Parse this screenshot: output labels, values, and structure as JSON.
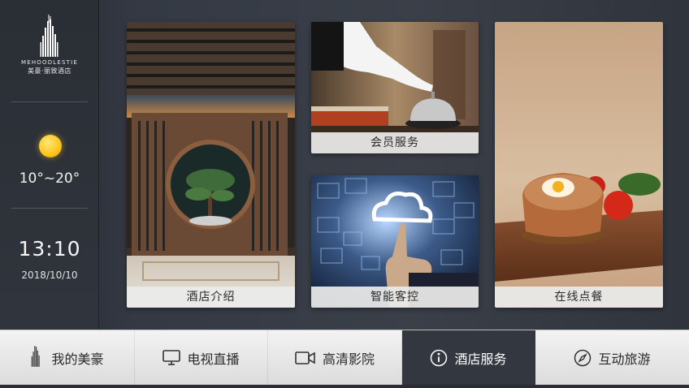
{
  "brand": {
    "name_en": "MEHOODLESTIE",
    "name_cn": "美豪·丽致酒店"
  },
  "weather": {
    "icon": "sun-icon",
    "temperature": "10°~20°"
  },
  "clock": {
    "time": "13:10",
    "date": "2018/10/10"
  },
  "tiles": {
    "hotel_intro": {
      "label": "酒店介绍"
    },
    "member_service": {
      "label": "会员服务"
    },
    "smart_control": {
      "label": "智能客控"
    },
    "online_dining": {
      "label": "在线点餐"
    }
  },
  "nav": {
    "items": [
      {
        "label": "我的美豪",
        "icon": "hotel-logo-icon"
      },
      {
        "label": "电视直播",
        "icon": "tv-icon"
      },
      {
        "label": "高清影院",
        "icon": "video-camera-icon"
      },
      {
        "label": "酒店服务",
        "icon": "info-icon",
        "active": true
      },
      {
        "label": "互动旅游",
        "icon": "compass-icon"
      }
    ]
  },
  "colors": {
    "background": "#343943",
    "nav_background": "#e8e8e8",
    "nav_active": "#33373f",
    "accent_sun": "#ffc51a"
  }
}
